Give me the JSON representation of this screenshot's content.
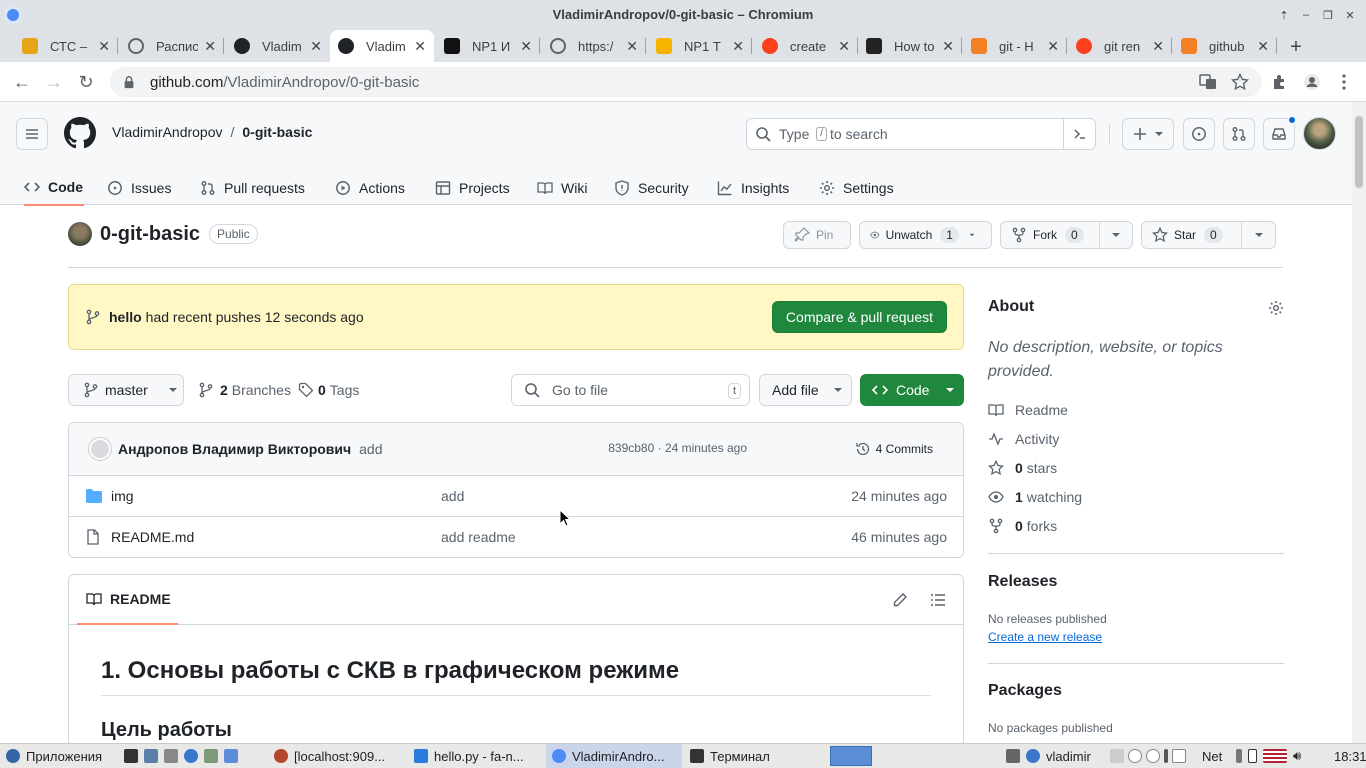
{
  "window": {
    "title": "VladimirAndropov/0-git-basic – Chromium"
  },
  "tabs": [
    {
      "label": "СТС –",
      "fav": "ctc",
      "color": "#e6a417"
    },
    {
      "label": "Распис",
      "fav": "globe",
      "color": "#5f6368"
    },
    {
      "label": "Vladim",
      "fav": "github",
      "color": "#1f2328"
    },
    {
      "label": "Vladim",
      "fav": "github",
      "color": "#1f2328",
      "active": true
    },
    {
      "label": "NP1 И",
      "fav": "np",
      "color": "#111"
    },
    {
      "label": "https:/",
      "fav": "globe",
      "color": "#5f6368"
    },
    {
      "label": "NP1 Т",
      "fav": "slides",
      "color": "#f4b400"
    },
    {
      "label": "create",
      "fav": "yandex",
      "color": "#fc3f1d"
    },
    {
      "label": "How to",
      "fav": "dark",
      "color": "#222"
    },
    {
      "label": "git - H",
      "fav": "stack",
      "color": "#f48024"
    },
    {
      "label": "git ren",
      "fav": "yandex",
      "color": "#fc3f1d"
    },
    {
      "label": "github",
      "fav": "stack",
      "color": "#f48024"
    }
  ],
  "address": {
    "host": "github.com",
    "path": "/VladimirAndropov/0-git-basic"
  },
  "header": {
    "owner": "VladimirAndropov",
    "repo": "0-git-basic",
    "search_prefix": "Type",
    "search_key": "/",
    "search_suffix": "to search"
  },
  "nav": [
    {
      "label": "Code",
      "icon": "code-icon",
      "active": true
    },
    {
      "label": "Issues",
      "icon": "issue-icon"
    },
    {
      "label": "Pull requests",
      "icon": "pull-request-icon"
    },
    {
      "label": "Actions",
      "icon": "play-icon"
    },
    {
      "label": "Projects",
      "icon": "table-icon"
    },
    {
      "label": "Wiki",
      "icon": "book-icon"
    },
    {
      "label": "Security",
      "icon": "shield-icon"
    },
    {
      "label": "Insights",
      "icon": "graph-icon"
    },
    {
      "label": "Settings",
      "icon": "gear-icon"
    }
  ],
  "repo": {
    "name": "0-git-basic",
    "visibility": "Public",
    "pin": "Pin",
    "watch": "Unwatch",
    "watch_count": "1",
    "fork": "Fork",
    "fork_count": "0",
    "star": "Star",
    "star_count": "0"
  },
  "banner": {
    "branch": "hello",
    "text": "had recent pushes 12 seconds ago",
    "button": "Compare & pull request"
  },
  "controls": {
    "branch": "master",
    "branches_count": "2",
    "branches_label": "Branches",
    "tags_count": "0",
    "tags_label": "Tags",
    "go_to_file": "Go to file",
    "go_to_file_key": "t",
    "add_file": "Add file",
    "code": "Code"
  },
  "commit": {
    "author": "Андропов Владимир Викторович",
    "message": "add",
    "info": "839cb80 · 24 minutes ago",
    "commits": "4 Commits"
  },
  "files": [
    {
      "name": "img",
      "type": "folder",
      "message": "add",
      "age": "24 minutes ago"
    },
    {
      "name": "README.md",
      "type": "file",
      "message": "add readme",
      "age": "46 minutes ago"
    }
  ],
  "readme": {
    "tab": "README",
    "h1": "1. Основы работы с СКВ в графическом режиме",
    "h2": "Цель работы"
  },
  "about": {
    "title": "About",
    "description": "No description, website, or topics provided.",
    "readme": "Readme",
    "activity": "Activity",
    "stars_count": "0",
    "stars_label": "stars",
    "watching_count": "1",
    "watching_label": "watching",
    "forks_count": "0",
    "forks_label": "forks"
  },
  "releases": {
    "title": "Releases",
    "note": "No releases published",
    "link": "Create a new release"
  },
  "packages": {
    "title": "Packages",
    "note": "No packages published"
  },
  "taskbar": {
    "apps": "Приложения",
    "items": [
      {
        "label": "[localhost:909...",
        "color": "#b5452e"
      },
      {
        "label": "hello.py - fa-n...",
        "color": "#2a7bde"
      },
      {
        "label": "VladimirAndro...",
        "color": "#4c8bf5",
        "active": true
      },
      {
        "label": "Терминал",
        "color": "#333"
      }
    ],
    "user": "vladimir",
    "net": "Net",
    "time": "18:31"
  }
}
